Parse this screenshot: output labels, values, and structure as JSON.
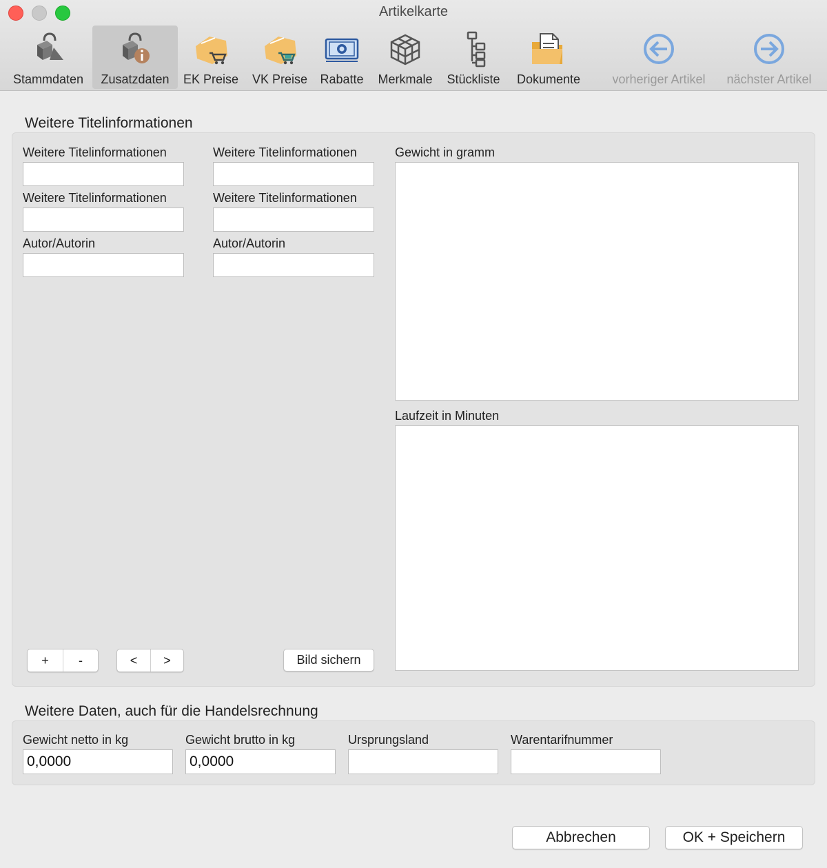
{
  "window": {
    "title": "Artikelkarte"
  },
  "toolbar": {
    "items": [
      {
        "label": "Stammdaten",
        "icon": "boxes-icon"
      },
      {
        "label": "Zusatzdaten",
        "icon": "boxes-info-icon"
      },
      {
        "label": "EK Preise",
        "icon": "cart-purchase-icon"
      },
      {
        "label": "VK Preise",
        "icon": "cart-sale-icon"
      },
      {
        "label": "Rabatte",
        "icon": "banknote-icon"
      },
      {
        "label": "Merkmale",
        "icon": "cube-grid-icon"
      },
      {
        "label": "Stückliste",
        "icon": "tree-list-icon"
      },
      {
        "label": "Dokumente",
        "icon": "folder-document-icon"
      },
      {
        "label": "vorheriger Artikel",
        "icon": "arrow-left-circle-icon"
      },
      {
        "label": "nächster Artikel",
        "icon": "arrow-right-circle-icon"
      }
    ]
  },
  "colors": {
    "accent_orange": "#f3c06a",
    "nav_blue": "#7aa7de",
    "active_tab": "#c9c9c9"
  },
  "section1": {
    "title": "Weitere Titelinformationen",
    "fields": [
      {
        "label": "Weitere Titelinformationen",
        "value": ""
      },
      {
        "label": "Weitere Titelinformationen",
        "value": ""
      },
      {
        "label": "Weitere Titelinformationen",
        "value": ""
      },
      {
        "label": "Weitere Titelinformationen",
        "value": ""
      },
      {
        "label": "Autor/Autorin",
        "value": ""
      },
      {
        "label": "Autor/Autorin",
        "value": ""
      }
    ],
    "weight_label": "Gewicht in gramm",
    "runtime_label": "Laufzeit in Minuten",
    "buttons": {
      "add": "+",
      "remove": "-",
      "prev": "<",
      "next": ">",
      "save_image": "Bild sichern"
    }
  },
  "section2": {
    "title": "Weitere Daten, auch für die Handelsrechnung",
    "fields": [
      {
        "label": "Gewicht netto in kg",
        "value": "0,0000"
      },
      {
        "label": "Gewicht brutto in kg",
        "value": "0,0000"
      },
      {
        "label": "Ursprungsland",
        "value": ""
      },
      {
        "label": "Warentarifnummer",
        "value": ""
      }
    ]
  },
  "footer": {
    "cancel": "Abbrechen",
    "ok": "OK + Speichern"
  }
}
